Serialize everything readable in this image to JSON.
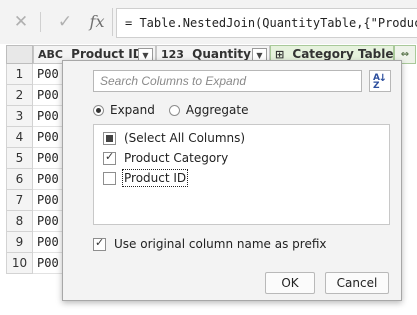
{
  "formula_bar": {
    "cancel_icon": "close-icon",
    "confirm_icon": "checkmark-icon",
    "fx_label": "fx",
    "formula": "= Table.NestedJoin(QuantityTable,{\"Product I"
  },
  "grid": {
    "columns": [
      {
        "type_label": "ABC",
        "label": "Product ID"
      },
      {
        "type_label": "123",
        "label": "Quantity"
      },
      {
        "type_label": "⊞",
        "label": "Category Table"
      }
    ],
    "expand_icon": "expand-columns-icon",
    "rows": [
      {
        "num": "1",
        "value": "P00"
      },
      {
        "num": "2",
        "value": "P00"
      },
      {
        "num": "3",
        "value": "P00"
      },
      {
        "num": "4",
        "value": "P00"
      },
      {
        "num": "5",
        "value": "P00"
      },
      {
        "num": "6",
        "value": "P00"
      },
      {
        "num": "7",
        "value": "P00"
      },
      {
        "num": "8",
        "value": "P00"
      },
      {
        "num": "9",
        "value": "P00"
      },
      {
        "num": "10",
        "value": "P00"
      }
    ]
  },
  "expand_popup": {
    "search_placeholder": "Search Columns to Expand",
    "sort_label_a": "A",
    "sort_label_z": "Z",
    "mode_options": [
      {
        "label": "Expand",
        "selected": true
      },
      {
        "label": "Aggregate",
        "selected": false
      }
    ],
    "columns": [
      {
        "label": "(Select All Columns)",
        "state": "indeterminate"
      },
      {
        "label": "Product Category",
        "state": "checked"
      },
      {
        "label": "Product ID",
        "state": "unchecked"
      }
    ],
    "prefix_option": {
      "label": "Use original column name as prefix",
      "checked": true
    },
    "ok_label": "OK",
    "cancel_label": "Cancel"
  }
}
